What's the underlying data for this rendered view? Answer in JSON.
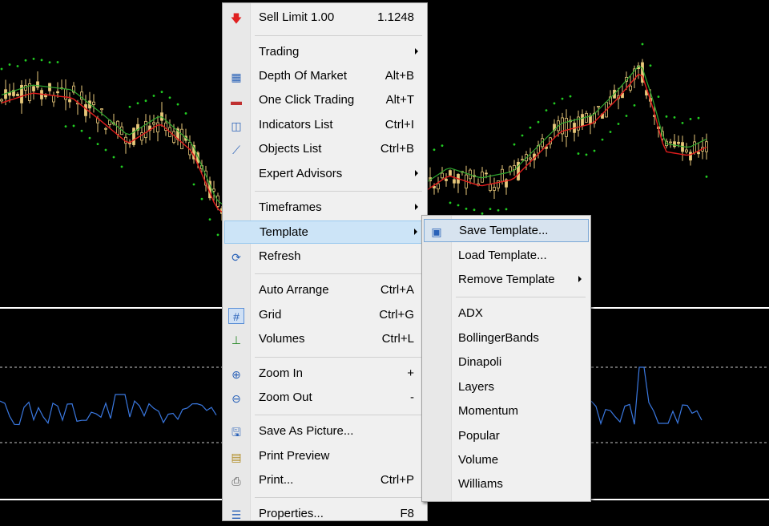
{
  "context_menu": {
    "items": [
      {
        "label": "Sell Limit 1.00",
        "shortcut": "1.1248",
        "icon": "sell-limit-icon"
      },
      {
        "label": "Trading",
        "shortcut": "",
        "submenu": true
      },
      {
        "label": "Depth Of Market",
        "shortcut": "Alt+B",
        "icon": "depth-of-market-icon"
      },
      {
        "label": "One Click Trading",
        "shortcut": "Alt+T",
        "icon": "one-click-trading-icon"
      },
      {
        "label": "Indicators List",
        "shortcut": "Ctrl+I",
        "icon": "indicators-list-icon"
      },
      {
        "label": "Objects List",
        "shortcut": "Ctrl+B",
        "icon": "objects-list-icon"
      },
      {
        "label": "Expert Advisors",
        "shortcut": "",
        "submenu": true
      },
      {
        "label": "Timeframes",
        "shortcut": "",
        "submenu": true
      },
      {
        "label": "Template",
        "shortcut": "",
        "submenu": true,
        "highlighted": true
      },
      {
        "label": "Refresh",
        "shortcut": "",
        "icon": "refresh-icon"
      },
      {
        "label": "Auto Arrange",
        "shortcut": "Ctrl+A"
      },
      {
        "label": "Grid",
        "shortcut": "Ctrl+G",
        "icon": "grid-icon",
        "checked": true
      },
      {
        "label": "Volumes",
        "shortcut": "Ctrl+L",
        "icon": "volumes-icon"
      },
      {
        "label": "Zoom In",
        "shortcut": "+",
        "icon": "zoom-in-icon"
      },
      {
        "label": "Zoom Out",
        "shortcut": "-",
        "icon": "zoom-out-icon"
      },
      {
        "label": "Save As Picture...",
        "shortcut": "",
        "icon": "save-as-picture-icon"
      },
      {
        "label": "Print Preview",
        "shortcut": "",
        "icon": "print-preview-icon"
      },
      {
        "label": "Print...",
        "shortcut": "Ctrl+P",
        "icon": "print-icon"
      },
      {
        "label": "Properties...",
        "shortcut": "F8",
        "icon": "properties-icon"
      }
    ]
  },
  "template_submenu": {
    "items": [
      {
        "label": "Save Template...",
        "icon": "save-template-icon",
        "highlighted": true
      },
      {
        "label": "Load Template..."
      },
      {
        "label": "Remove Template",
        "submenu": true
      },
      {
        "label": "ADX"
      },
      {
        "label": "BollingerBands"
      },
      {
        "label": "Dinapoli"
      },
      {
        "label": "Layers"
      },
      {
        "label": "Momentum"
      },
      {
        "label": "Popular"
      },
      {
        "label": "Volume"
      },
      {
        "label": "Williams"
      }
    ]
  },
  "colors": {
    "background": "#000000",
    "candles": "#e8c87a",
    "moving_average_red": "#e11d1d",
    "moving_average_green": "#2fa82f",
    "parabolic_sar": "#22cc22",
    "oscillator": "#3a78e0",
    "menu_bg": "#f0f0f0",
    "menu_highlight": "#cce4f7"
  }
}
